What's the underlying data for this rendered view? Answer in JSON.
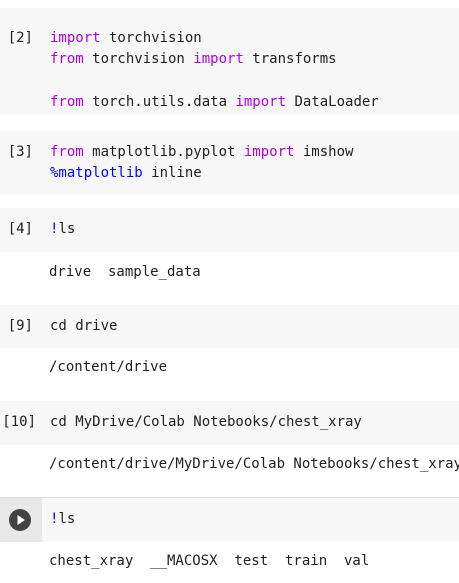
{
  "cells": [
    {
      "prompt": "[2]",
      "lines": [
        [
          {
            "t": "import",
            "k": "kw"
          },
          {
            "t": " torchvision",
            "k": ""
          }
        ],
        [
          {
            "t": "from",
            "k": "kw"
          },
          {
            "t": " torchvision ",
            "k": ""
          },
          {
            "t": "import",
            "k": "kw"
          },
          {
            "t": " transforms",
            "k": ""
          }
        ],
        [],
        [
          {
            "t": "from",
            "k": "kw"
          },
          {
            "t": " torch.utils.data ",
            "k": ""
          },
          {
            "t": "import",
            "k": "kw"
          },
          {
            "t": " DataLoader",
            "k": ""
          }
        ]
      ],
      "output": null
    },
    {
      "prompt": "[3]",
      "lines": [
        [
          {
            "t": "from",
            "k": "kw"
          },
          {
            "t": " matplotlib.pyplot ",
            "k": ""
          },
          {
            "t": "import",
            "k": "kw"
          },
          {
            "t": " imshow",
            "k": ""
          }
        ],
        [
          {
            "t": "%matplotlib",
            "k": "bang"
          },
          {
            "t": " inline",
            "k": ""
          }
        ]
      ],
      "output": null
    },
    {
      "prompt": "[4]",
      "lines": [
        [
          {
            "t": "!",
            "k": "bang"
          },
          {
            "t": "ls",
            "k": ""
          }
        ]
      ],
      "output": "drive  sample_data"
    },
    {
      "prompt": "[9]",
      "lines": [
        [
          {
            "t": "cd drive",
            "k": ""
          }
        ]
      ],
      "output": "/content/drive"
    },
    {
      "prompt": "[10]",
      "lines": [
        [
          {
            "t": "cd MyDrive/Colab Notebooks/chest_xray",
            "k": ""
          }
        ]
      ],
      "output": "/content/drive/MyDrive/Colab Notebooks/chest_xray"
    },
    {
      "prompt": "",
      "active": true,
      "lines": [
        [
          {
            "t": "!",
            "k": "bang"
          },
          {
            "t": "ls",
            "k": ""
          }
        ]
      ],
      "output": "chest_xray  __MACOSX  test  train  val"
    }
  ],
  "icons": {
    "run": "play-icon"
  },
  "colors": {
    "keyword": "#af00db",
    "magic": "#0000ff",
    "cell_bg": "#f7f7f7",
    "run_button": "#424242"
  }
}
